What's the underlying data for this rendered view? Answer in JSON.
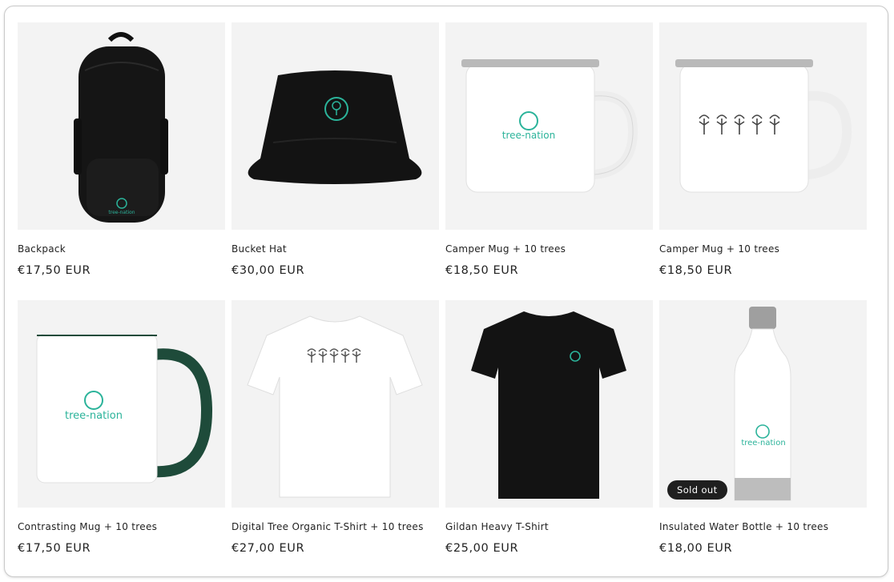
{
  "products": [
    {
      "title": "Backpack",
      "price": "€17,50 EUR",
      "image": "black-backpack-tree-nation-logo"
    },
    {
      "title": "Bucket Hat",
      "price": "€30,00 EUR",
      "image": "black-bucket-hat-tree-logo"
    },
    {
      "title": "Camper Mug + 10 trees",
      "price": "€18,50 EUR",
      "image": "white-enamel-mug-tree-nation-logo"
    },
    {
      "title": "Camper Mug + 10 trees",
      "price": "€18,50 EUR",
      "image": "white-enamel-mug-five-trees"
    },
    {
      "title": "Contrasting Mug + 10 trees",
      "price": "€17,50 EUR",
      "image": "white-mug-green-handle-tree-nation-logo"
    },
    {
      "title": "Digital Tree Organic T-Shirt + 10 trees",
      "price": "€27,00 EUR",
      "image": "white-tshirt-five-trees"
    },
    {
      "title": "Gildan Heavy T-Shirt",
      "price": "€25,00 EUR",
      "image": "black-tshirt-tree-logo"
    },
    {
      "title": "Insulated Water Bottle + 10 trees",
      "price": "€18,00 EUR",
      "image": "white-bottle-tree-nation-logo",
      "badge": "Sold out"
    }
  ],
  "logo_text": "tree-nation",
  "colors": {
    "accent": "#2bb39a",
    "text": "#222222",
    "thumb_bg": "#f3f3f3",
    "badge_bg": "#1f1f1f"
  }
}
